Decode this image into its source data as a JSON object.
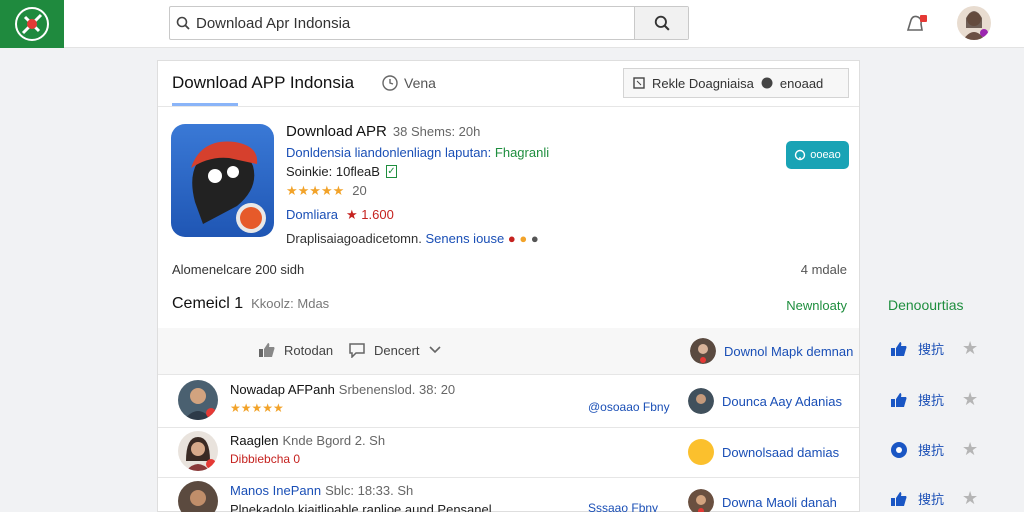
{
  "search": {
    "value": "Download Apr Indonsia"
  },
  "card": {
    "title": "Download APP Indonsia",
    "vena": "Vena",
    "header_button": "Rekle Doagniaisa",
    "header_button2": "enoaad"
  },
  "app": {
    "name": "Download APR",
    "name_meta": "38 Shems: 20h",
    "desc_blue": "Donldensia liandonlenliagn laputan:",
    "desc_green": "Fhagranli",
    "size": "Soinkie: 10fleaB",
    "rating_stars": "★★★★★",
    "rating_count": "20",
    "developer": "Domliara",
    "developer_rating": "★ 1.600",
    "tags": "Draplisaiagoadicetomn.",
    "tags_blue": "Senens iouse",
    "install_label": "ooeao"
  },
  "stats": {
    "left": "Alomenelcare 200 sidh",
    "right": "4 mdale"
  },
  "comments": {
    "label": "Cemeicl 1",
    "sub": "Kkoolz: Mdas",
    "newest": "Newnloaty"
  },
  "actions": {
    "like": "Rotodan",
    "comment": "Dencert",
    "download": "Downol Mapk demnan"
  },
  "reviews": [
    {
      "name": "Nowadap AFPanh",
      "meta": "Srbenenslod. 38: 20",
      "stars": "★★★★★",
      "link": "@osoaao Fbny",
      "right": "Dounca Aay Adanias"
    },
    {
      "name": "Raaglen",
      "meta": "Knde Bgord  2. Sh",
      "sub": "Dibbiebcha 0",
      "link": "",
      "right": "Downolsaad damias"
    },
    {
      "name": "Manos InePann",
      "meta": "Sblc: 18:33. Sh",
      "sub": "Plnekadolo kiaitlioable ranlioe aund Pensanel",
      "link": "Sssaao Fbny",
      "right": "Downa Maoli danah"
    }
  ],
  "side": {
    "title": "Denoourtias",
    "label": "搜抗"
  },
  "colors": {
    "brand_green": "#1f8a3e",
    "install_teal": "#19a3b5",
    "link_blue": "#1a4fb6"
  }
}
